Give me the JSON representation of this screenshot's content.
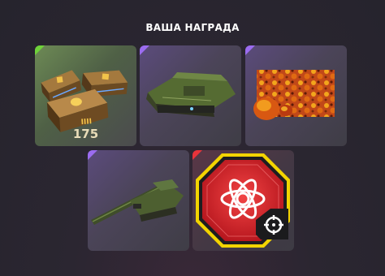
{
  "header": {
    "title": "ВАША НАГРАДА"
  },
  "rewards": [
    {
      "kind": "containers",
      "quantity": "175",
      "rarity_color": "#6fd23a"
    },
    {
      "kind": "hull",
      "rarity_color": "#9b6cf0"
    },
    {
      "kind": "paint",
      "rarity_color": "#9b6cf0"
    },
    {
      "kind": "turret",
      "rarity_color": "#9b6cf0"
    },
    {
      "kind": "augment",
      "rarity_color": "#e8333a"
    }
  ],
  "colors": {
    "rare_green": "#6fd23a",
    "epic_purple": "#9b6cf0",
    "legendary_red": "#e8333a",
    "augment_border": "#f3d400"
  }
}
